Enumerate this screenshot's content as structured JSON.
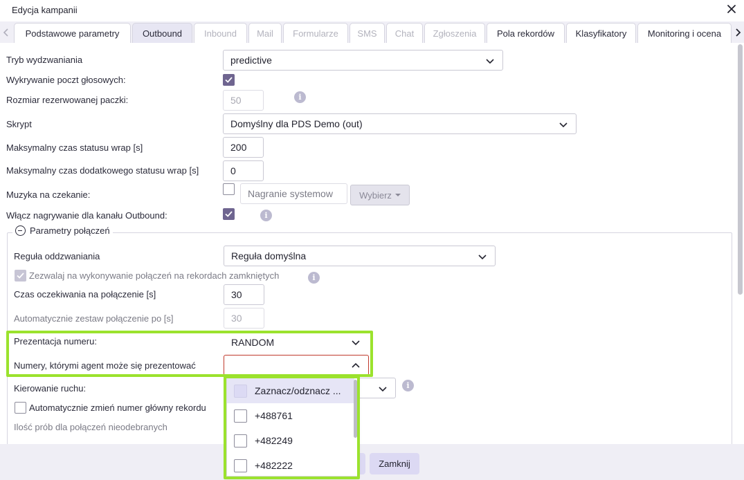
{
  "dialog": {
    "title": "Edycja kampanii"
  },
  "tabs": [
    {
      "label": "Podstawowe parametry",
      "state": "normal"
    },
    {
      "label": "Outbound",
      "state": "active"
    },
    {
      "label": "Inbound",
      "state": "disabled"
    },
    {
      "label": "Mail",
      "state": "disabled"
    },
    {
      "label": "Formularze",
      "state": "disabled"
    },
    {
      "label": "SMS",
      "state": "disabled"
    },
    {
      "label": "Chat",
      "state": "disabled"
    },
    {
      "label": "Zgłoszenia",
      "state": "disabled"
    },
    {
      "label": "Pola rekordów",
      "state": "normal"
    },
    {
      "label": "Klasyfikatory",
      "state": "normal"
    },
    {
      "label": "Monitoring i ocena",
      "state": "normal"
    }
  ],
  "form": {
    "dial_mode": {
      "label": "Tryb wydzwaniania",
      "value": "predictive"
    },
    "voicemail_detection": {
      "label": "Wykrywanie poczt głosowych:",
      "checked": true
    },
    "reserved_batch": {
      "label": "Rozmiar rezerwowanej paczki:",
      "value": "50"
    },
    "script": {
      "label": "Skrypt",
      "value": "Domyślny dla PDS Demo (out)"
    },
    "max_wrap": {
      "label": "Maksymalny czas statusu wrap [s]",
      "value": "200"
    },
    "max_extra_wrap": {
      "label": "Maksymalny czas dodatkowego statusu wrap [s]",
      "value": "0"
    },
    "hold_music": {
      "label": "Muzyka na czekanie:",
      "checked": false,
      "value": "Nagranie systemow",
      "button": "Wybierz"
    },
    "record_outbound": {
      "label": "Włącz nagrywanie dla kanału Outbound:",
      "checked": true
    }
  },
  "connection_params": {
    "legend": "Parametry połączeń",
    "callback_rule": {
      "label": "Reguła oddzwaniania",
      "value": "Reguła domyślna"
    },
    "allow_closed": {
      "label": "Zezwalaj na wykonywanie połączeń na rekordach zamkniętych",
      "checked": true
    },
    "wait_time": {
      "label": "Czas oczekiwania na połączenie [s]",
      "value": "30"
    },
    "auto_hangup": {
      "label": "Automatycznie zestaw połączenie po [s]",
      "value": "30"
    },
    "number_presentation": {
      "label": "Prezentacja numeru:",
      "value": "RANDOM"
    },
    "agent_numbers": {
      "label": "Numery, którymi agent może się prezentować",
      "value": ""
    },
    "traffic_routing": {
      "label": "Kierowanie ruchu:"
    },
    "auto_change_main": {
      "label": "Automatycznie zmień numer główny rekordu",
      "checked": false
    },
    "retry_unanswered": {
      "label": "Ilość prób dla połączeń nieodebranych"
    }
  },
  "dropdown": {
    "items": [
      {
        "label": "Zaznacz/odznacz ..."
      },
      {
        "label": "+488761"
      },
      {
        "label": "+482249"
      },
      {
        "label": "+482222"
      }
    ]
  },
  "footer": {
    "close_label": "Zamknij"
  },
  "colors": {
    "accent": "#6f6590",
    "highlight": "#9be22d",
    "button": "#dcd9f3"
  }
}
